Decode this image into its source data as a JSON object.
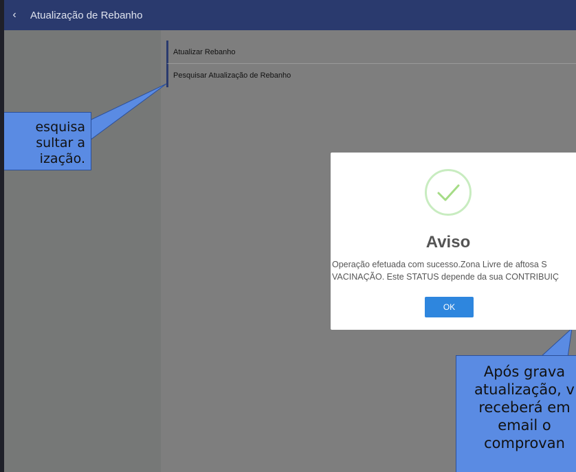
{
  "topbar": {
    "back_icon": "chevron-left-icon",
    "back_glyph": "‹",
    "title": "Atualização de Rebanho"
  },
  "menu": {
    "items": [
      {
        "label": "Atualizar Rebanho"
      },
      {
        "label": "Pesquisar Atualização de Rebanho"
      }
    ]
  },
  "callouts": {
    "left_lines": [
      "esquisa",
      "sultar a",
      "ização."
    ],
    "right_lines": [
      "Após grava",
      "atualização, v",
      "receberá em",
      "email o",
      "comprovan"
    ]
  },
  "modal": {
    "icon": "check-icon",
    "title": "Aviso",
    "message_line1": "Operação efetuada com sucesso.Zona Livre de aftosa S",
    "message_line2": "VACINAÇÃO. Este STATUS depende da sua CONTRIBUIÇ",
    "ok_label": "OK"
  },
  "colors": {
    "topbar": "#2a3a6e",
    "callout": "#5a8be3",
    "ok_button": "#2e86de",
    "check": "#a5dc86"
  }
}
